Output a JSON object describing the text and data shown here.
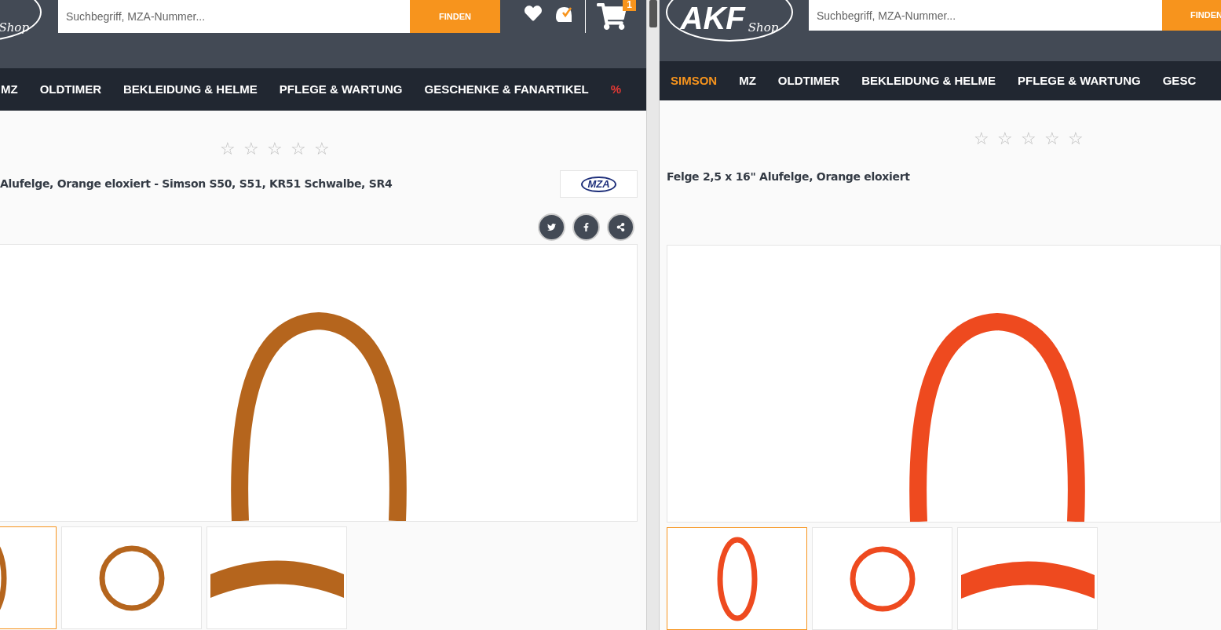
{
  "windows": [
    {
      "logo": {
        "subtext": "Shop"
      },
      "search": {
        "placeholder": "Suchbegriff, MZA-Nummer...",
        "button": "FINDEN"
      },
      "cart_count": "1",
      "nav": [
        {
          "label": "MZ",
          "selected": false,
          "kind": "normal"
        },
        {
          "label": "OLDTIMER",
          "selected": false,
          "kind": "normal"
        },
        {
          "label": "BEKLEIDUNG & HELME",
          "selected": false,
          "kind": "normal"
        },
        {
          "label": "PFLEGE & WARTUNG",
          "selected": false,
          "kind": "normal"
        },
        {
          "label": "GESCHENKE & FANARTIKEL",
          "selected": false,
          "kind": "normal"
        },
        {
          "label": "%",
          "selected": false,
          "kind": "sale"
        }
      ],
      "rating": {
        "stars": 0
      },
      "title": "Alufelge, Orange eloxiert - Simson S50, S51, KR51 Schwalbe, SR4",
      "brand": "MZA",
      "share_buttons": [
        {
          "kind": "twitter"
        },
        {
          "kind": "facebook"
        },
        {
          "kind": "share"
        }
      ],
      "thumbnails": [
        {
          "selected": true,
          "kind": "side"
        },
        {
          "selected": false,
          "kind": "front"
        },
        {
          "selected": false,
          "kind": "close"
        }
      ]
    },
    {
      "logo": {
        "text": "AKF",
        "subtext": "Shop"
      },
      "search": {
        "placeholder": "Suchbegriff, MZA-Nummer...",
        "button": "FINDEN"
      },
      "nav": [
        {
          "label": "SIMSON",
          "selected": true,
          "kind": "normal"
        },
        {
          "label": "MZ",
          "selected": false,
          "kind": "normal"
        },
        {
          "label": "OLDTIMER",
          "selected": false,
          "kind": "normal"
        },
        {
          "label": "BEKLEIDUNG & HELME",
          "selected": false,
          "kind": "normal"
        },
        {
          "label": "PFLEGE & WARTUNG",
          "selected": false,
          "kind": "normal"
        },
        {
          "label": "GESC",
          "selected": false,
          "kind": "normal"
        }
      ],
      "rating": {
        "stars": 0
      },
      "title": "Felge 2,5 x 16\" Alufelge, Orange eloxiert",
      "thumbnails": [
        {
          "selected": true,
          "kind": "side"
        },
        {
          "selected": false,
          "kind": "front"
        },
        {
          "selected": false,
          "kind": "close"
        }
      ]
    }
  ]
}
